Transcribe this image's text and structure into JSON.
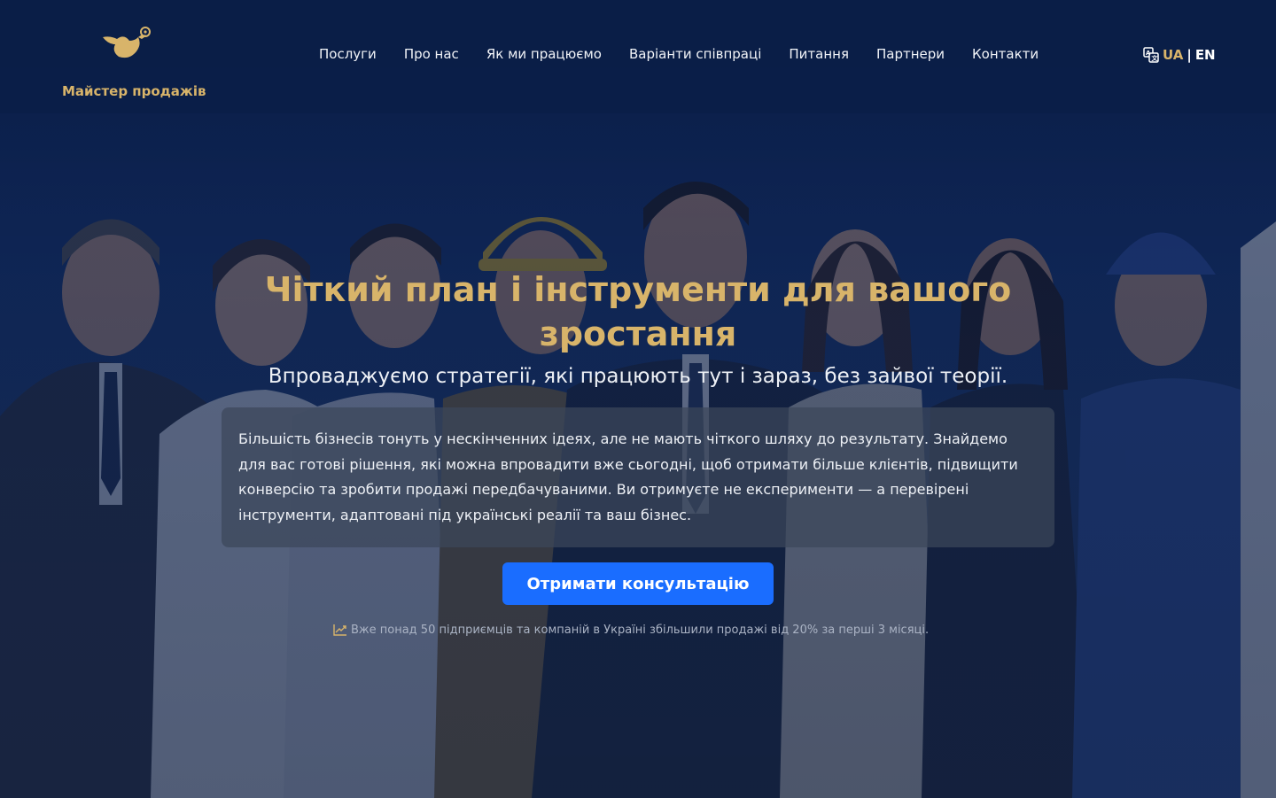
{
  "brand": {
    "name": "Майстер продажів",
    "accent_color": "#d8b46a"
  },
  "nav": {
    "items": [
      {
        "label": "Послуги"
      },
      {
        "label": "Про нас"
      },
      {
        "label": "Як ми працюємо"
      },
      {
        "label": "Варіанти співпраці"
      },
      {
        "label": "Питання"
      },
      {
        "label": "Партнери"
      },
      {
        "label": "Контакти"
      }
    ]
  },
  "lang": {
    "icon": "translate-icon",
    "ua": "UA",
    "separator": "|",
    "en": "EN",
    "active": "UA"
  },
  "hero": {
    "title": "Чіткий план і інструменти для вашого зростання",
    "subtitle": "Впроваджуємо стратегії, які працюють тут і зараз, без зайвої теорії.",
    "body": "Більшість бізнесів тонуть у нескінченних ідеях, але не мають чіткого шляху до результату. Знайдемо для вас готові рішення, які можна впровадити вже сьогодні, щоб отримати більше клієнтів, підвищити конверсію та зробити продажі передбачуваними. Ви отримуєте не експерименти — а перевірені інструменти, адаптовані під українські реалії та ваш бізнес.",
    "cta_label": "Отримати консультацію",
    "cta_color": "#1a6dff",
    "note_icon": "chart-line-icon",
    "note": "Вже понад 50 підприємців та компаній в Україні збільшили продажі від 20% за перші 3 місяці."
  }
}
